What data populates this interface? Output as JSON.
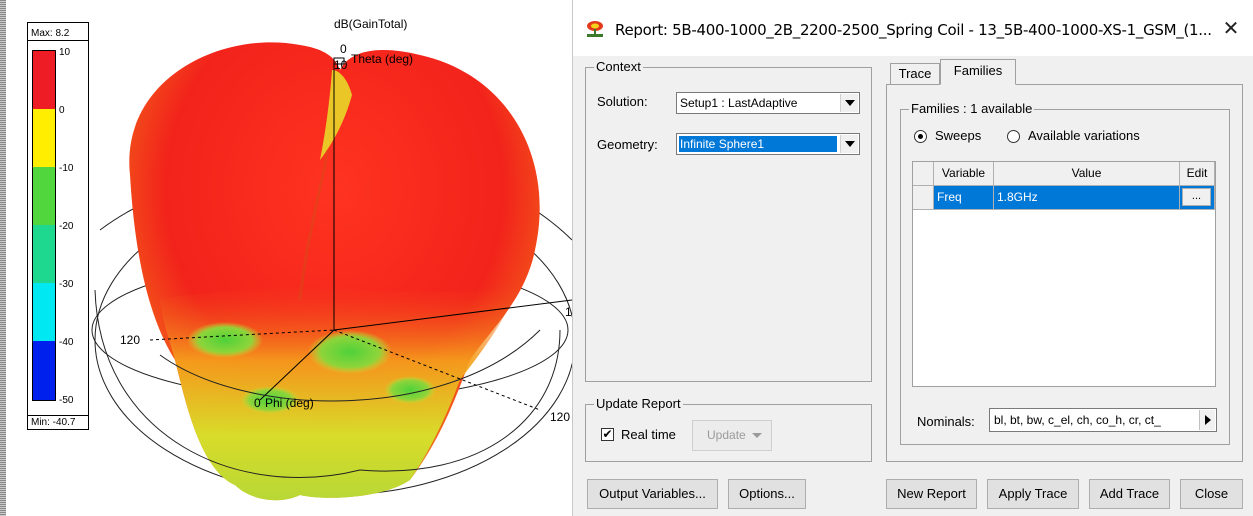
{
  "plot": {
    "title": "dB(GainTotal)",
    "theta_axis_label": "Theta (deg)",
    "theta_zero": "0",
    "theta_ten": "10",
    "phi_axis_label": "Phi (deg)",
    "phi_zero": "0",
    "left_ring_label": "120",
    "right_ring_label": "120",
    "right_edge_label": "1",
    "legend": {
      "max_label": "Max: 8.2",
      "min_label": "Min: -40.7",
      "ticks": [
        "10",
        "0",
        "-10",
        "-20",
        "-30",
        "-40",
        "-50"
      ],
      "colors": [
        "#ee1c25",
        "#ffee00",
        "#52d63e",
        "#1fd890",
        "#00e8f2",
        "#0020ee"
      ]
    }
  },
  "dialog": {
    "title": "Report: 5B-400-1000_2B_2200-2500_Spring Coil - 13_5B-400-1000-XS-1_GSM_(1...",
    "close_glyph": "✕",
    "context": {
      "caption": "Context",
      "solution_label": "Solution:",
      "solution_value": "Setup1 : LastAdaptive",
      "geometry_label": "Geometry:",
      "geometry_value": "Infinite Sphere1"
    },
    "update_report": {
      "caption": "Update Report",
      "realtime_label": "Real time",
      "realtime_checked": "✔",
      "update_button": "Update"
    },
    "tabs": [
      "Trace",
      "Families"
    ],
    "families": {
      "caption": "Families : 1 available",
      "radio_sweeps": "Sweeps",
      "radio_variations": "Available variations",
      "columns": [
        "Variable",
        "Value",
        "Edit"
      ],
      "rows": [
        {
          "variable": "Freq",
          "value": "1.8GHz",
          "edit": "..."
        }
      ],
      "nominals_label": "Nominals:",
      "nominals_value": "bl, bt, bw, c_el, ch, co_h, cr, ct_"
    },
    "buttons": {
      "output_variables": "Output Variables...",
      "options": "Options...",
      "new_report": "New Report",
      "apply_trace": "Apply Trace",
      "add_trace": "Add Trace",
      "close": "Close"
    }
  },
  "colors": {
    "selection": "#0078d7",
    "dialog_bg": "#f0f0f0"
  }
}
